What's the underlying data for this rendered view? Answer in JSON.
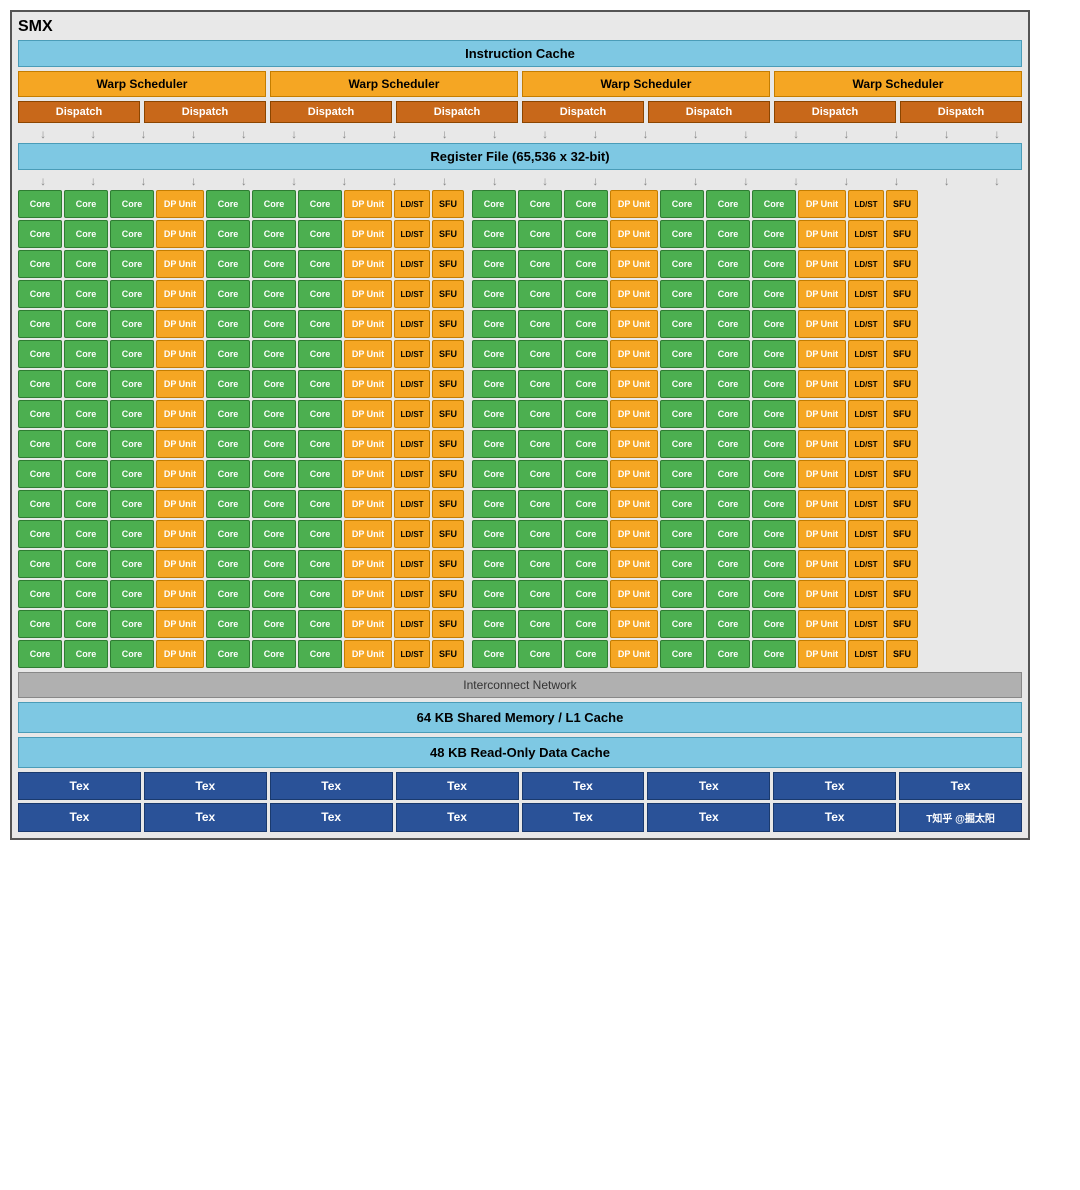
{
  "title": "SMX",
  "instruction_cache": "Instruction Cache",
  "warp_schedulers": [
    "Warp Scheduler",
    "Warp Scheduler",
    "Warp Scheduler",
    "Warp Scheduler"
  ],
  "dispatch_units": [
    "Dispatch",
    "Dispatch",
    "Dispatch",
    "Dispatch",
    "Dispatch",
    "Dispatch",
    "Dispatch",
    "Dispatch"
  ],
  "register_file": "Register File (65,536 x 32-bit)",
  "num_rows": 16,
  "interconnect": "Interconnect Network",
  "shared_memory": "64 KB Shared Memory / L1 Cache",
  "readonly_cache": "48 KB Read-Only Data Cache",
  "tex_row1": [
    "Tex",
    "Tex",
    "Tex",
    "Tex",
    "Tex",
    "Tex",
    "Tex",
    "Tex"
  ],
  "tex_row2_labels": [
    "Tex",
    "Tex",
    "Tex",
    "Tex",
    "Tex",
    "Tex",
    "T知乎 @掘太阳"
  ],
  "watermark": "T知乎 @掘太阳"
}
